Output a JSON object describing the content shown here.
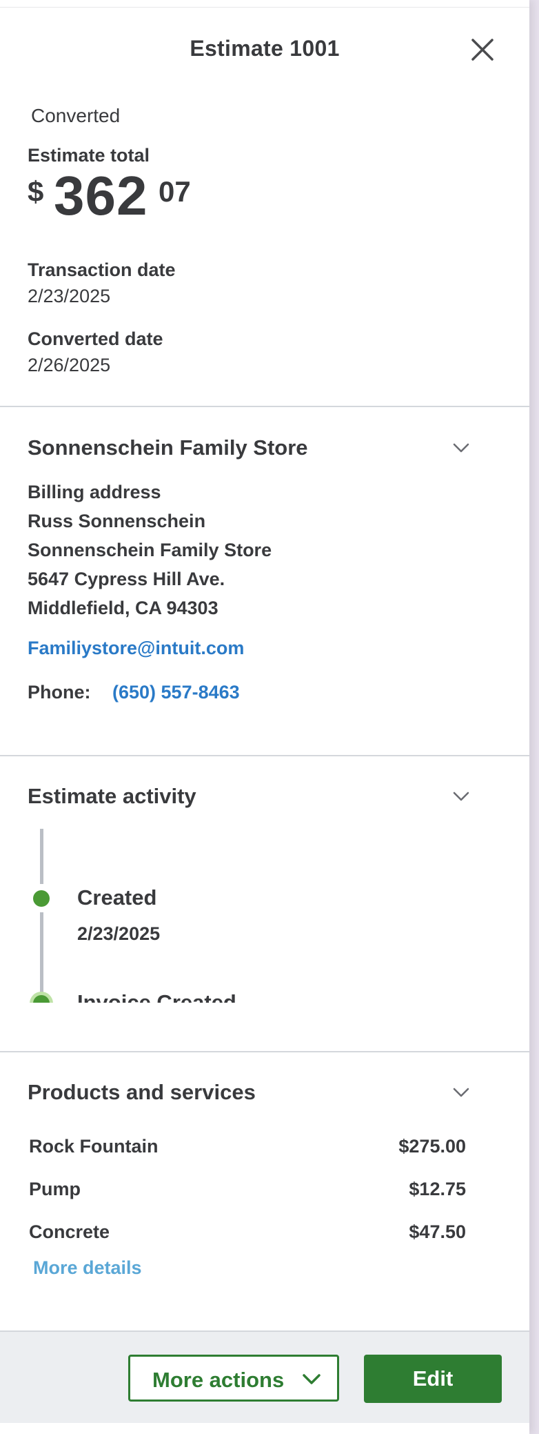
{
  "header": {
    "title": "Estimate 1001"
  },
  "summary": {
    "status": "Converted",
    "total_label": "Estimate total",
    "total_currency": "$",
    "total_whole": "362",
    "total_cents": "07",
    "transaction_date_label": "Transaction date",
    "transaction_date": "2/23/2025",
    "converted_date_label": "Converted date",
    "converted_date": "2/26/2025"
  },
  "customer": {
    "name": "Sonnenschein Family Store",
    "billing_label": "Billing address",
    "address_lines": [
      "Russ Sonnenschein",
      "Sonnenschein Family Store",
      "5647 Cypress Hill Ave.",
      "Middlefield, CA  94303"
    ],
    "email": "Familiystore@intuit.com",
    "phone_label": "Phone:",
    "phone": "(650) 557-8463"
  },
  "activity": {
    "title": "Estimate activity",
    "events": [
      {
        "label": "Created",
        "date": "2/23/2025"
      },
      {
        "label": "Invoice Created",
        "date": ""
      }
    ]
  },
  "products": {
    "title": "Products and services",
    "items": [
      {
        "name": "Rock Fountain",
        "price": "$275.00"
      },
      {
        "name": "Pump",
        "price": "$12.75"
      },
      {
        "name": "Concrete",
        "price": "$47.50"
      }
    ],
    "more_link": "More details"
  },
  "footer": {
    "more_actions_label": "More actions",
    "edit_label": "Edit"
  },
  "colors": {
    "accent_green": "#2e7d32",
    "link_blue": "#2a7ac7",
    "timeline_green": "#4a9a35"
  },
  "icons": {
    "close": "close-icon",
    "chevron": "chevron-down-icon"
  }
}
